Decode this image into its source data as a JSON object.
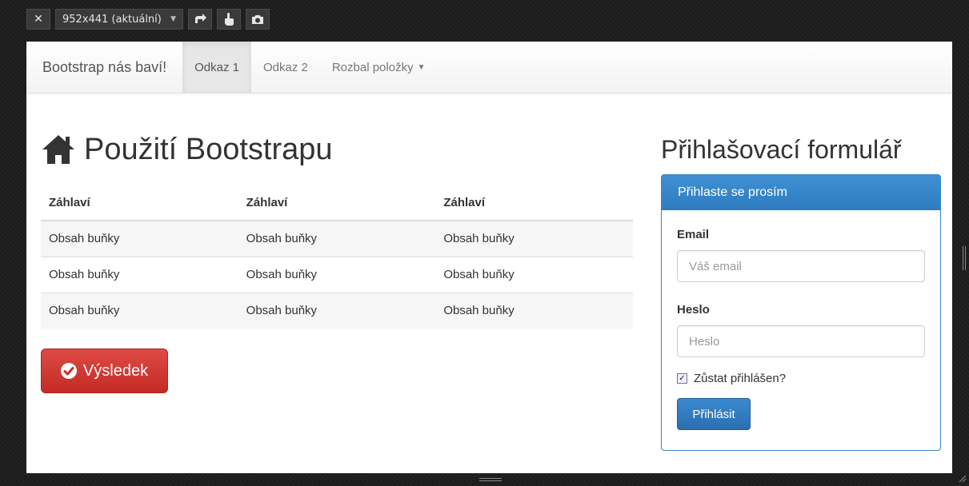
{
  "devtools": {
    "close_icon": "close-icon",
    "device_select": "952x441 (aktuální)",
    "rotate_icon": "rotate-icon",
    "touch_icon": "touch-icon",
    "screenshot_icon": "camera-icon"
  },
  "navbar": {
    "brand": "Bootstrap nás baví!",
    "items": [
      {
        "label": "Odkaz 1",
        "active": true
      },
      {
        "label": "Odkaz 2",
        "active": false
      },
      {
        "label": "Rozbal položky",
        "active": false,
        "dropdown": true
      }
    ]
  },
  "main": {
    "heading_icon": "home-icon",
    "heading": "Použití Bootstrapu",
    "table": {
      "headers": [
        "Záhlaví",
        "Záhlaví",
        "Záhlaví"
      ],
      "rows": [
        [
          "Obsah buňky",
          "Obsah buňky",
          "Obsah buňky"
        ],
        [
          "Obsah buňky",
          "Obsah buňky",
          "Obsah buňky"
        ],
        [
          "Obsah buňky",
          "Obsah buňky",
          "Obsah buňky"
        ]
      ]
    },
    "result_button": "Výsledek"
  },
  "side": {
    "title": "Přihlašovací formulář",
    "panel_heading": "Přihlaste se prosím",
    "email_label": "Email",
    "email_placeholder": "Váš email",
    "password_label": "Heslo",
    "password_placeholder": "Heslo",
    "remember_label": "Zůstat přihlášen?",
    "remember_checked": true,
    "login_button": "Přihlásit"
  },
  "colors": {
    "primary": "#337ab7",
    "danger": "#d9534f"
  }
}
